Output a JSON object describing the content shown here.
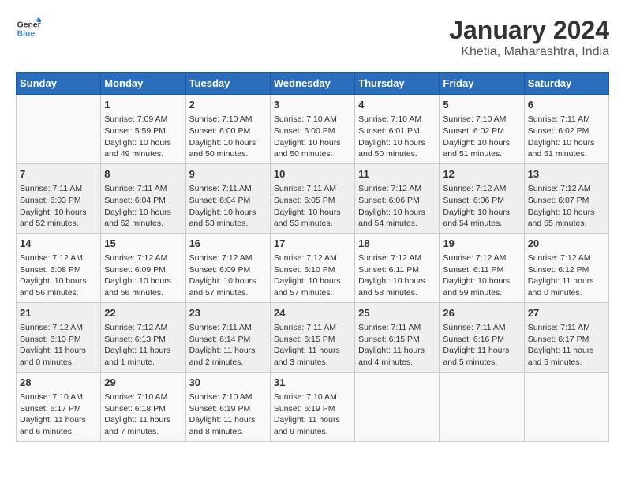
{
  "header": {
    "logo_line1": "General",
    "logo_line2": "Blue",
    "month_year": "January 2024",
    "location": "Khetia, Maharashtra, India"
  },
  "columns": [
    "Sunday",
    "Monday",
    "Tuesday",
    "Wednesday",
    "Thursday",
    "Friday",
    "Saturday"
  ],
  "weeks": [
    [
      {
        "day": "",
        "info": ""
      },
      {
        "day": "1",
        "info": "Sunrise: 7:09 AM\nSunset: 5:59 PM\nDaylight: 10 hours\nand 49 minutes."
      },
      {
        "day": "2",
        "info": "Sunrise: 7:10 AM\nSunset: 6:00 PM\nDaylight: 10 hours\nand 50 minutes."
      },
      {
        "day": "3",
        "info": "Sunrise: 7:10 AM\nSunset: 6:00 PM\nDaylight: 10 hours\nand 50 minutes."
      },
      {
        "day": "4",
        "info": "Sunrise: 7:10 AM\nSunset: 6:01 PM\nDaylight: 10 hours\nand 50 minutes."
      },
      {
        "day": "5",
        "info": "Sunrise: 7:10 AM\nSunset: 6:02 PM\nDaylight: 10 hours\nand 51 minutes."
      },
      {
        "day": "6",
        "info": "Sunrise: 7:11 AM\nSunset: 6:02 PM\nDaylight: 10 hours\nand 51 minutes."
      }
    ],
    [
      {
        "day": "7",
        "info": "Sunrise: 7:11 AM\nSunset: 6:03 PM\nDaylight: 10 hours\nand 52 minutes."
      },
      {
        "day": "8",
        "info": "Sunrise: 7:11 AM\nSunset: 6:04 PM\nDaylight: 10 hours\nand 52 minutes."
      },
      {
        "day": "9",
        "info": "Sunrise: 7:11 AM\nSunset: 6:04 PM\nDaylight: 10 hours\nand 53 minutes."
      },
      {
        "day": "10",
        "info": "Sunrise: 7:11 AM\nSunset: 6:05 PM\nDaylight: 10 hours\nand 53 minutes."
      },
      {
        "day": "11",
        "info": "Sunrise: 7:12 AM\nSunset: 6:06 PM\nDaylight: 10 hours\nand 54 minutes."
      },
      {
        "day": "12",
        "info": "Sunrise: 7:12 AM\nSunset: 6:06 PM\nDaylight: 10 hours\nand 54 minutes."
      },
      {
        "day": "13",
        "info": "Sunrise: 7:12 AM\nSunset: 6:07 PM\nDaylight: 10 hours\nand 55 minutes."
      }
    ],
    [
      {
        "day": "14",
        "info": "Sunrise: 7:12 AM\nSunset: 6:08 PM\nDaylight: 10 hours\nand 56 minutes."
      },
      {
        "day": "15",
        "info": "Sunrise: 7:12 AM\nSunset: 6:09 PM\nDaylight: 10 hours\nand 56 minutes."
      },
      {
        "day": "16",
        "info": "Sunrise: 7:12 AM\nSunset: 6:09 PM\nDaylight: 10 hours\nand 57 minutes."
      },
      {
        "day": "17",
        "info": "Sunrise: 7:12 AM\nSunset: 6:10 PM\nDaylight: 10 hours\nand 57 minutes."
      },
      {
        "day": "18",
        "info": "Sunrise: 7:12 AM\nSunset: 6:11 PM\nDaylight: 10 hours\nand 58 minutes."
      },
      {
        "day": "19",
        "info": "Sunrise: 7:12 AM\nSunset: 6:11 PM\nDaylight: 10 hours\nand 59 minutes."
      },
      {
        "day": "20",
        "info": "Sunrise: 7:12 AM\nSunset: 6:12 PM\nDaylight: 11 hours\nand 0 minutes."
      }
    ],
    [
      {
        "day": "21",
        "info": "Sunrise: 7:12 AM\nSunset: 6:13 PM\nDaylight: 11 hours\nand 0 minutes."
      },
      {
        "day": "22",
        "info": "Sunrise: 7:12 AM\nSunset: 6:13 PM\nDaylight: 11 hours\nand 1 minute."
      },
      {
        "day": "23",
        "info": "Sunrise: 7:11 AM\nSunset: 6:14 PM\nDaylight: 11 hours\nand 2 minutes."
      },
      {
        "day": "24",
        "info": "Sunrise: 7:11 AM\nSunset: 6:15 PM\nDaylight: 11 hours\nand 3 minutes."
      },
      {
        "day": "25",
        "info": "Sunrise: 7:11 AM\nSunset: 6:15 PM\nDaylight: 11 hours\nand 4 minutes."
      },
      {
        "day": "26",
        "info": "Sunrise: 7:11 AM\nSunset: 6:16 PM\nDaylight: 11 hours\nand 5 minutes."
      },
      {
        "day": "27",
        "info": "Sunrise: 7:11 AM\nSunset: 6:17 PM\nDaylight: 11 hours\nand 5 minutes."
      }
    ],
    [
      {
        "day": "28",
        "info": "Sunrise: 7:10 AM\nSunset: 6:17 PM\nDaylight: 11 hours\nand 6 minutes."
      },
      {
        "day": "29",
        "info": "Sunrise: 7:10 AM\nSunset: 6:18 PM\nDaylight: 11 hours\nand 7 minutes."
      },
      {
        "day": "30",
        "info": "Sunrise: 7:10 AM\nSunset: 6:19 PM\nDaylight: 11 hours\nand 8 minutes."
      },
      {
        "day": "31",
        "info": "Sunrise: 7:10 AM\nSunset: 6:19 PM\nDaylight: 11 hours\nand 9 minutes."
      },
      {
        "day": "",
        "info": ""
      },
      {
        "day": "",
        "info": ""
      },
      {
        "day": "",
        "info": ""
      }
    ]
  ]
}
